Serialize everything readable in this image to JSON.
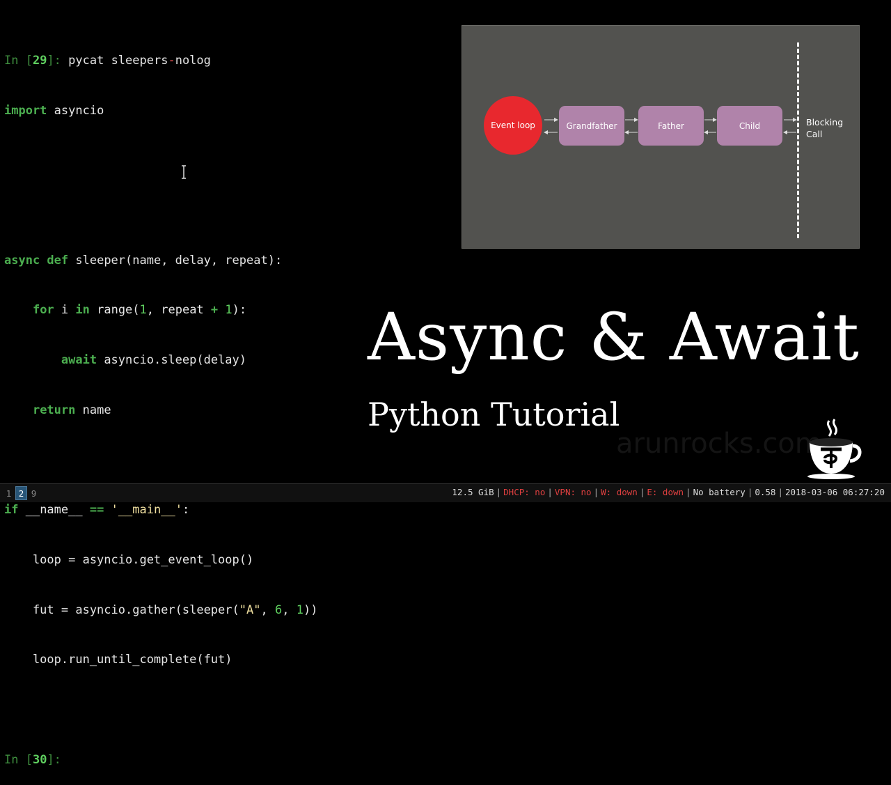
{
  "terminal": {
    "prompt1": {
      "prefix": "In [",
      "num": "29",
      "suffix": "]:",
      "command": " pycat sleepers",
      "dash": "-",
      "cmd_rest": "nolog"
    },
    "code": {
      "l1_kw": "import",
      "l1_rest": " asyncio",
      "l4_kw1": "async",
      "l4_kw2": " def",
      "l4_rest": " sleeper(name, delay, repeat):",
      "l5_a": "    ",
      "l5_kw": "for",
      "l5_b": " i ",
      "l5_kw2": "in",
      "l5_c": " range(",
      "l5_n1": "1",
      "l5_d": ", repeat ",
      "l5_op": "+",
      "l5_e": " ",
      "l5_n2": "1",
      "l5_f": "):",
      "l6_a": "        ",
      "l6_kw": "await",
      "l6_b": " asyncio.sleep(delay)",
      "l7_a": "    ",
      "l7_kw": "return",
      "l7_b": " name",
      "l9_kw": "if",
      "l9_a": " __name__ ",
      "l9_op": "==",
      "l9_b": " ",
      "l9_str": "'__main__'",
      "l9_c": ":",
      "l10": "    loop = asyncio.get_event_loop()",
      "l11_a": "    fut = asyncio.gather(sleeper(",
      "l11_str": "\"A\"",
      "l11_b": ", ",
      "l11_n1": "6",
      "l11_c": ", ",
      "l11_n2": "1",
      "l11_d": "))",
      "l12": "    loop.run_until_complete(fut)"
    },
    "prompt2": {
      "prefix": "In [",
      "num": "30",
      "suffix": "]:"
    }
  },
  "diagram": {
    "event_loop": "Event loop",
    "frames": [
      "Grandfather",
      "Father",
      "Child"
    ],
    "blocking_line1": "Blocking",
    "blocking_line2": "Call"
  },
  "title": {
    "main": "Async & Await",
    "subtitle": "Python Tutorial",
    "watermark": "arunrocks.com"
  },
  "statusbar": {
    "workspaces": [
      {
        "label": "1",
        "active": false
      },
      {
        "label": "2",
        "active": true
      },
      {
        "label": "9",
        "active": false
      }
    ],
    "memory": "12.5 GiB",
    "dhcp": "DHCP: no",
    "vpn": "VPN: no",
    "wifi": "W: down",
    "ethernet": "E: down",
    "battery": "No battery",
    "load": "0.58",
    "datetime": "2018-03-06 06:27:20"
  },
  "colors": {
    "event_loop": "#e8282e",
    "frame": "#b083aa",
    "diagram_bg": "#52524f",
    "status_bad": "#e04040",
    "active_workspace": "#285577"
  }
}
